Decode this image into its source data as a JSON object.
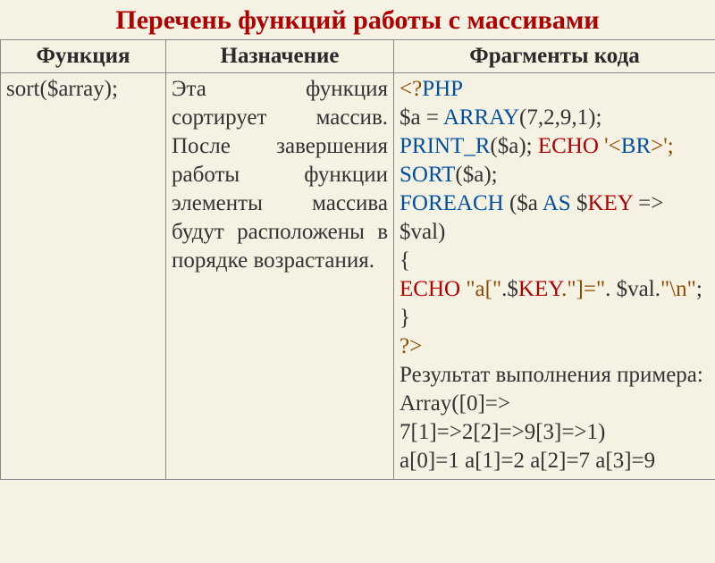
{
  "title": "Перечень функций работы с массивами",
  "headers": {
    "func": "Функция",
    "desc": "Назначение",
    "code": "Фрагменты кода"
  },
  "row": {
    "func": "sort($array);",
    "desc": "Эта функция сортирует массив. После завершения работы функции элементы массива будут расположены в порядке возрастания.",
    "code": {
      "l1a": "<?",
      "l1b": "PHP",
      "l2a": "$a = ",
      "l2b": "ARRAY",
      "l2c": "(7,2,9,1);",
      "l3a": "PRINT_R",
      "l3b": "($a); ",
      "l3c": "ECHO",
      "l3d": " '<",
      "l3e": "BR",
      "l3f": ">';",
      "l4a": "SORT",
      "l4b": "($a);",
      "l5a": "FOREACH",
      "l5b": " ($a ",
      "l5c": "AS",
      "l5d": " $",
      "l5e": "KEY",
      "l5f": " => $val)",
      "l6": "{",
      "l7a": "  ",
      "l7b": "ECHO",
      "l7c": " \"a[\"",
      "l7d": ".$",
      "l7e": "KEY",
      "l7f": ".\"]=\"",
      "l7g": ". $val.",
      "l7h": "\"\\n\"",
      "l7i": ";",
      "l8": "}",
      "l9": "?>",
      "res_label": "Результат выполнения примера:",
      "res1": "Array([0]=> 7[1]=>2[2]=>9[3]=>1)",
      "res2": "a[0]=1 a[1]=2 a[2]=7 a[3]=9"
    }
  }
}
